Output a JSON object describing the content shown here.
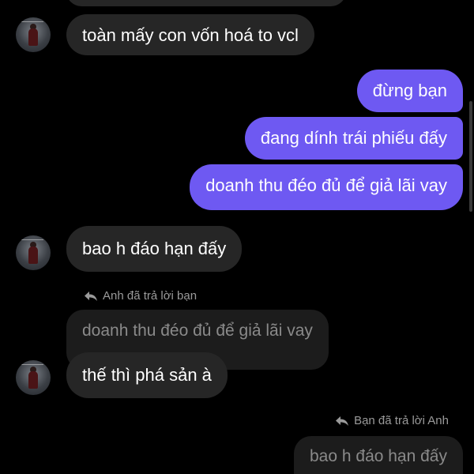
{
  "colors": {
    "background": "#000000",
    "incoming_bubble": "#262626",
    "outgoing_bubble": "#6e59f2",
    "quoted_bubble": "#1c1c1c",
    "muted_text": "#9a9a9a"
  },
  "messages": {
    "m1": "toàn mấy con vốn hoá to vcl",
    "m2": "đừng bạn",
    "m3": "đang dính trái phiếu đấy",
    "m4": "doanh thu đéo đủ để giả lãi vay",
    "m5": "bao h đáo hạn đấy",
    "m6_reply_label": "Anh đã trả lời bạn",
    "m6_quote": "doanh thu đéo đủ để giả lãi vay",
    "m6": "thế thì phá sản à",
    "m7_reply_label": "Bạn đã trả lời Anh",
    "m7_quote": "bao h đáo hạn đấy"
  },
  "icons": {
    "avatar": "contact-avatar",
    "reply": "reply-arrow-icon"
  }
}
